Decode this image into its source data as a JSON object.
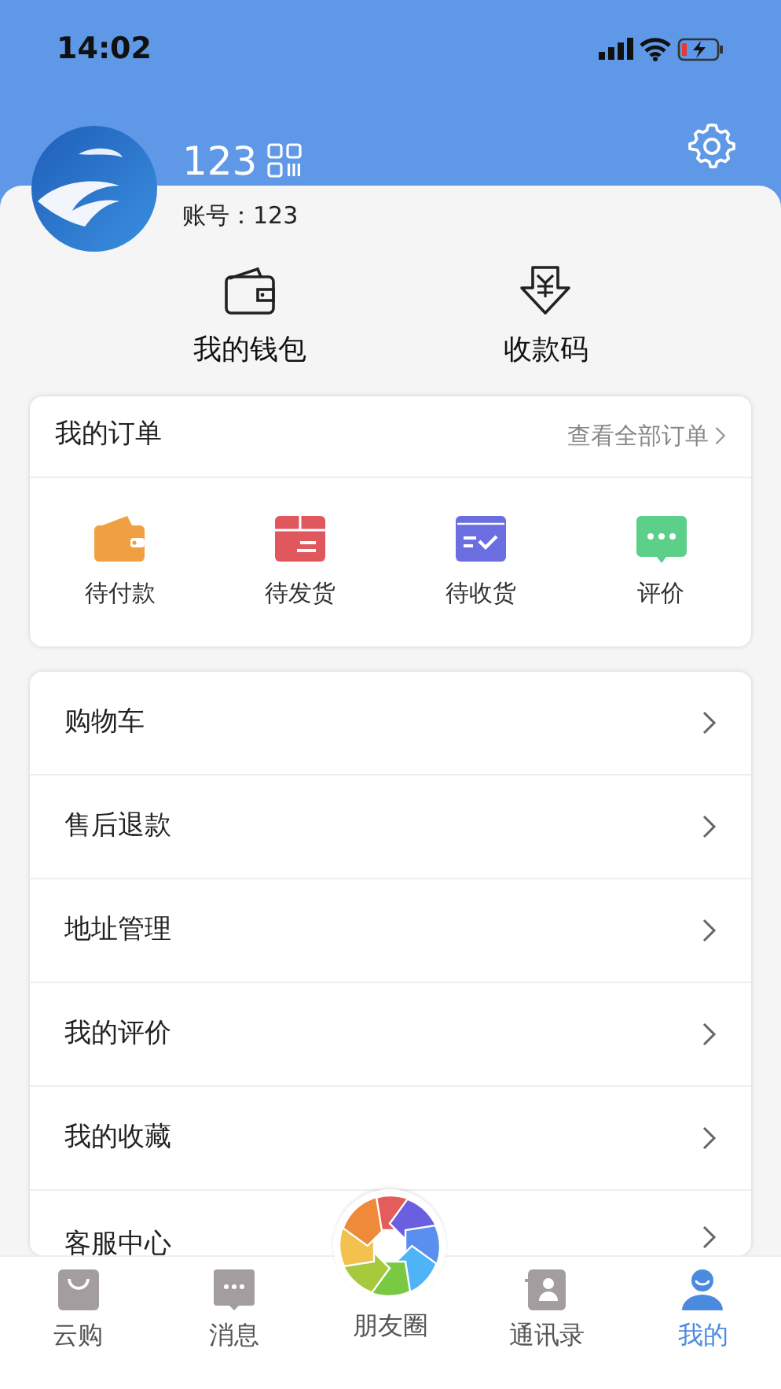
{
  "status_bar": {
    "time": "14:02"
  },
  "profile": {
    "name": "123",
    "account": "账号：123"
  },
  "quick_actions": [
    {
      "kind": "wallet",
      "label": "我的钱包"
    },
    {
      "kind": "receive",
      "label": "收款码"
    }
  ],
  "orders": {
    "title": "我的订单",
    "view_all": "查看全部订单",
    "items": [
      {
        "kind": "pay",
        "label": "待付款",
        "color": "#f0a042"
      },
      {
        "kind": "ship",
        "label": "待发货",
        "color": "#e0585e"
      },
      {
        "kind": "receive",
        "label": "待收货",
        "color": "#6b6ee0"
      },
      {
        "kind": "review",
        "label": "评价",
        "color": "#5ccf88"
      }
    ]
  },
  "menu": [
    "购物车",
    "售后退款",
    "地址管理",
    "我的评价",
    "我的收藏",
    "客服中心"
  ],
  "tabs": [
    {
      "kind": "shop",
      "label": "云购",
      "selected": false
    },
    {
      "kind": "message",
      "label": "消息",
      "selected": false
    },
    {
      "kind": "moments",
      "label": "朋友圈",
      "selected": false
    },
    {
      "kind": "contacts",
      "label": "通讯录",
      "selected": false
    },
    {
      "kind": "me",
      "label": "我的",
      "selected": true
    }
  ]
}
